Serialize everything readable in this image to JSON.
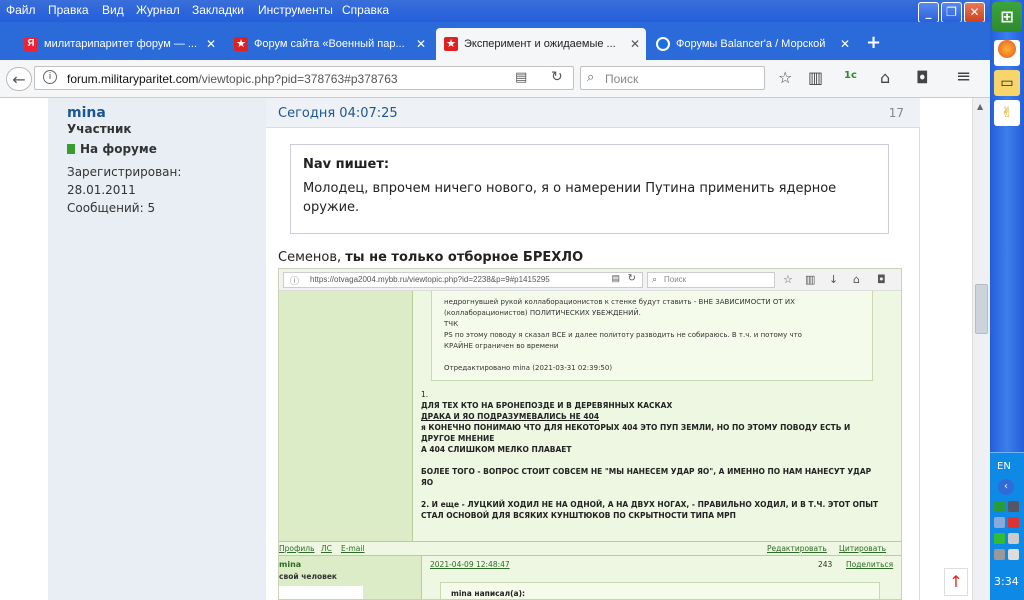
{
  "menubar": {
    "items": [
      "Файл",
      "Правка",
      "Вид",
      "Журнал",
      "Закладки",
      "Инструменты",
      "Справка"
    ]
  },
  "tabs": [
    {
      "label": "милитарипаритет форум — ...",
      "icon": "yandex-icon",
      "active": false
    },
    {
      "label": "Форум сайта «Военный пар...",
      "icon": "star-icon",
      "active": false
    },
    {
      "label": "Эксперимент и ожидаемые ...",
      "icon": "star-icon",
      "active": true
    },
    {
      "label": "Форумы Balancer'a / Морской",
      "icon": "balancer-icon",
      "active": false
    }
  ],
  "newtab_label": "+",
  "nav": {
    "url_host": "forum.militaryparitet.com",
    "url_path": "/viewtopic.php?pid=378763#p378763",
    "search_placeholder": "Поиск"
  },
  "user": {
    "name": "mina",
    "role": "Участник",
    "online": "На форуме",
    "reg_label": "Зарегистрирован:",
    "reg_date": "28.01.2011",
    "posts": "Сообщений: 5"
  },
  "post": {
    "time": "Сегодня 04:07:25",
    "number": "17",
    "quote_header": "Nav пишет:",
    "quote_text": "Молодец, впрочем ничего нового, я о намерении Путина применить ядерное оружие.",
    "reply_prefix": "Семенов, ",
    "reply_bold": "ты не только отборное БРЕХЛО"
  },
  "inner": {
    "url": "https://otvaga2004.mybb.ru/viewtopic.php?id=2238&p=9#p1415295",
    "search_placeholder": "Поиск",
    "quote_lines": [
      "недрогнувшей рукой коллаборационистов  к стенке будут ставить  - ВНЕ ЗАВИСИМОСТИ ОТ ИХ",
      "(коллаборационистов) ПОЛИТИЧЕСКИХ УБЕЖДЕНИЙ.",
      "ТЧК",
      "PS по этому поводу я сказал ВСЕ и далее политоту разводить не собираюсь. В т.ч. и потому что",
      "КРАЙНЕ ограничен во времени",
      "",
      "Отредактировано mina (2021-03-31 02:39:50)"
    ],
    "body_lines": [
      "1.",
      "ДЛЯ ТЕХ КТО НА БРОНЕПОЗДЕ И В ДЕРЕВЯННЫХ КАСКАХ",
      "ДРАКА И ЯО ПОДРАЗУМЕВАЛИСЬ НЕ 404",
      "я КОНЕЧНО ПОНИМАЮ ЧТО ДЛЯ НЕКОТОРЫХ 404 ЭТО ПУП ЗЕМЛИ, НО ПО ЭТОМУ ПОВОДУ ЕСТЬ И",
      "ДРУГОЕ МНЕНИЕ",
      "А 404 СЛИШКОМ МЕЛКО ПЛАВАЕТ",
      "",
      "БОЛЕЕ ТОГО - ВОПРОС СТОИТ СОВСЕМ НЕ \"МЫ НАНЕСЕМ УДАР ЯО\", А ИМЕННО ПО НАМ НАНЕСУТ УДАР",
      "ЯО",
      "",
      "2. И еще - ЛУЦКИЙ ХОДИЛ НЕ НА ОДНОЙ, А НА ДВУХ НОГАХ, - ПРАВИЛЬНО ХОДИЛ, И В Т.Ч. ЭТОТ ОПЫТ",
      "СТАЛ ОСНОВОЙ ДЛЯ ВСЯКИХ КУНШТЮКОВ ПО СКРЫТНОСТИ ТИПА МРП"
    ],
    "footer": {
      "profile": "Профиль",
      "ls": "ЛС",
      "email": "E-mail",
      "edit": "Редактировать",
      "cite": "Цитировать"
    },
    "post2": {
      "user": "mina",
      "title": "свой человек",
      "date": "2021-04-09 12:48:47",
      "num": "243",
      "share": "Поделиться",
      "quote_head": "mina написал(а):"
    }
  },
  "taskbar": {
    "lang": "EN",
    "clock": "3:34"
  }
}
